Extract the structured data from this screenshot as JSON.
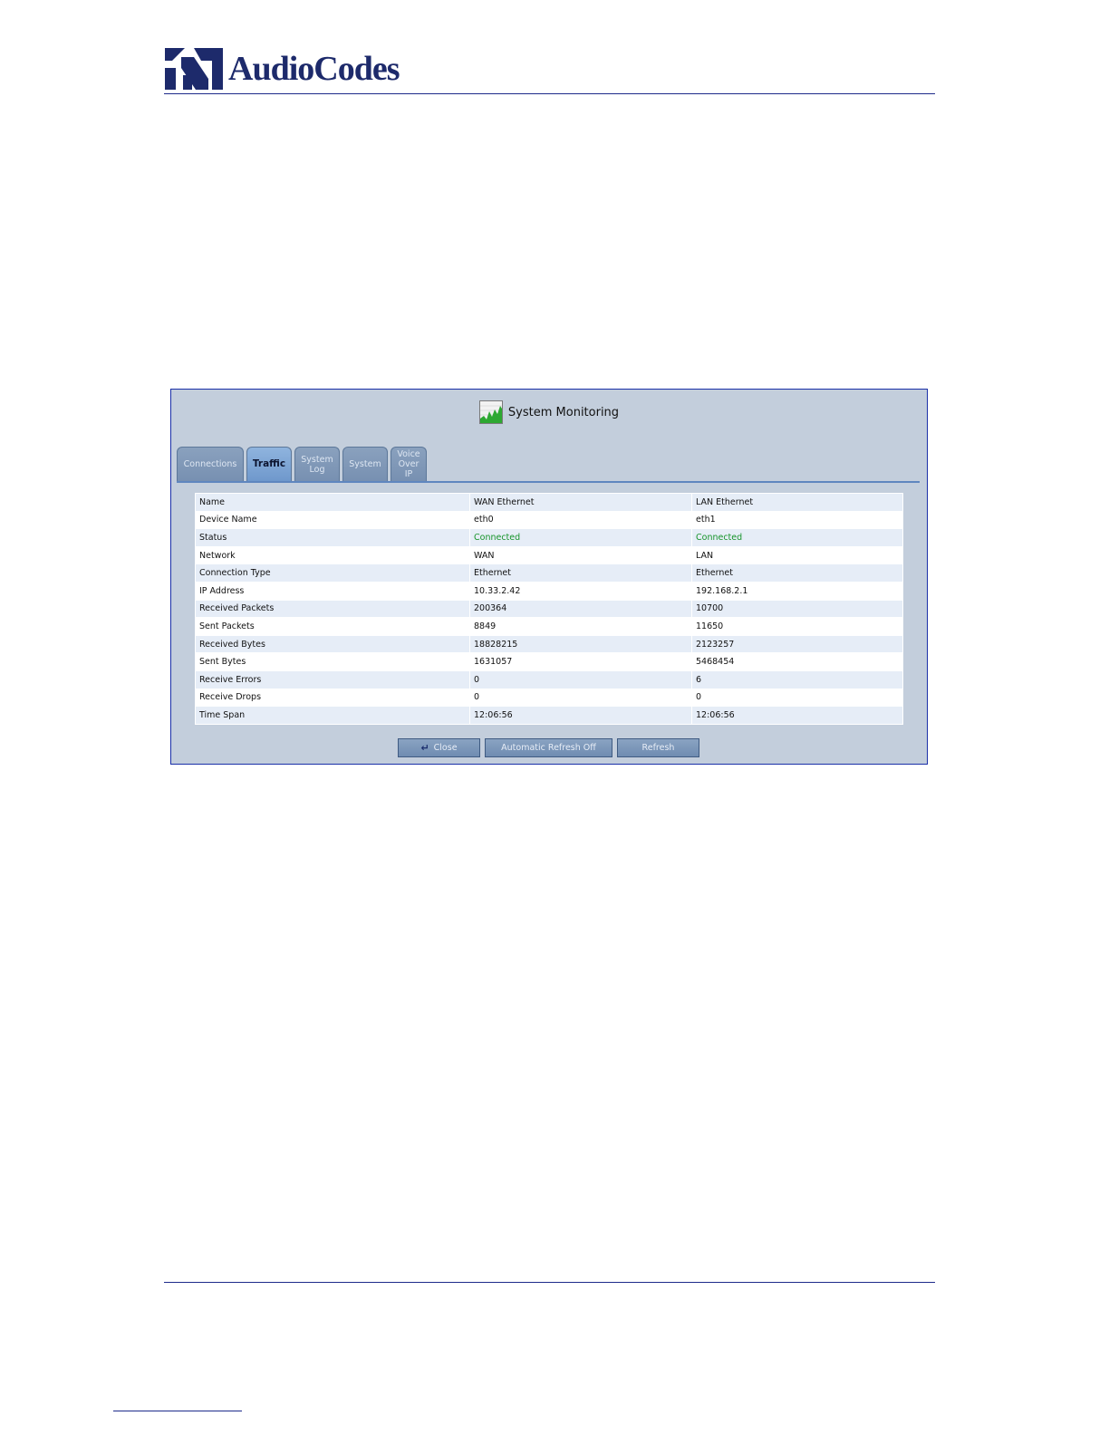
{
  "header": {
    "logo_text": "AudioCodes"
  },
  "window": {
    "title": "System Monitoring",
    "title_icon": "traffic-graph-icon"
  },
  "tabs": [
    {
      "label": "Connections",
      "active": false
    },
    {
      "label": "Traffic",
      "active": true
    },
    {
      "label": "System Log",
      "active": false
    },
    {
      "label": "System",
      "active": false
    },
    {
      "label": "Voice Over IP",
      "active": false
    }
  ],
  "table": {
    "header": [
      "Name",
      "WAN Ethernet",
      "LAN Ethernet"
    ],
    "rows": [
      [
        "Device Name",
        "eth0",
        "eth1"
      ],
      [
        "Status",
        "Connected",
        "Connected"
      ],
      [
        "Network",
        "WAN",
        "LAN"
      ],
      [
        "Connection Type",
        "Ethernet",
        "Ethernet"
      ],
      [
        "IP Address",
        "10.33.2.42",
        "192.168.2.1"
      ],
      [
        "Received Packets",
        "200364",
        "10700"
      ],
      [
        "Sent Packets",
        "8849",
        "11650"
      ],
      [
        "Received Bytes",
        "18828215",
        "2123257"
      ],
      [
        "Sent Bytes",
        "1631057",
        "5468454"
      ],
      [
        "Receive Errors",
        "0",
        "6"
      ],
      [
        "Receive Drops",
        "0",
        "0"
      ],
      [
        "Time Span",
        "12:06:56",
        "12:06:56"
      ]
    ]
  },
  "buttons": {
    "close": "Close",
    "auto_refresh": "Automatic Refresh Off",
    "refresh": "Refresh"
  },
  "colors": {
    "brand": "#1d2a6b",
    "status_ok": "#17942a"
  }
}
